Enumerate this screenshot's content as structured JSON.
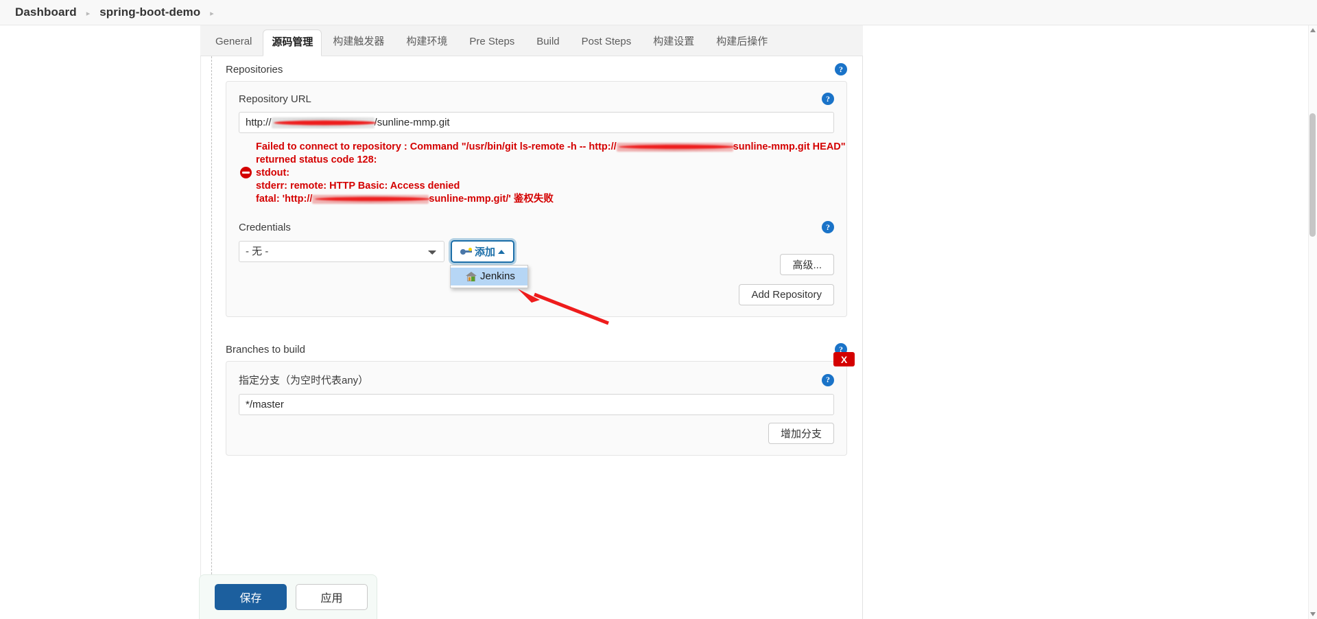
{
  "breadcrumb": {
    "items": [
      "Dashboard",
      "spring-boot-demo"
    ],
    "separator": "▸"
  },
  "tabs": [
    {
      "label": "General",
      "active": false
    },
    {
      "label": "源码管理",
      "active": true
    },
    {
      "label": "构建触发器",
      "active": false
    },
    {
      "label": "构建环境",
      "active": false
    },
    {
      "label": "Pre Steps",
      "active": false
    },
    {
      "label": "Build",
      "active": false
    },
    {
      "label": "Post Steps",
      "active": false
    },
    {
      "label": "构建设置",
      "active": false
    },
    {
      "label": "构建后操作",
      "active": false
    }
  ],
  "help_glyph": "?",
  "repositories": {
    "section_title": "Repositories",
    "repository_url": {
      "label": "Repository URL",
      "value_prefix": "http://",
      "value_suffix": "/sunline-mmp.git",
      "redacted": true
    },
    "error": {
      "line1_a": "Failed to connect to repository : Command \"/usr/bin/git ls-remote -h -- http://",
      "line1_b": "sunline-mmp.git HEAD\"",
      "line2": "returned status code 128:",
      "line3": "stdout:",
      "line4": "stderr: remote: HTTP Basic: Access denied",
      "line5_a": "fatal: 'http://",
      "line5_b": "sunline-mmp.git/' 鉴权失败",
      "color": "#d40000"
    },
    "credentials": {
      "label": "Credentials",
      "selected": "- 无 -",
      "options": [
        "- 无 -"
      ],
      "add_button": "添加",
      "add_icon": "key-icon",
      "dropdown_open": true,
      "dropdown_items": [
        {
          "label": "Jenkins",
          "icon": "house-icon",
          "highlighted": true
        }
      ]
    },
    "advanced_button": "高级...",
    "add_repository_button": "Add Repository"
  },
  "branches": {
    "section_title": "Branches to build",
    "delete_label": "X",
    "branch_field": {
      "label": "指定分支（为空时代表any）",
      "value": "*/master"
    },
    "add_branch_button": "增加分支"
  },
  "footer": {
    "save_label": "保存",
    "apply_label": "应用"
  },
  "colors": {
    "accent": "#1c5f9e",
    "error": "#d40000",
    "help": "#1a73c8",
    "highlight": "#b6d6f5",
    "annotation": "#ee1c1c"
  }
}
